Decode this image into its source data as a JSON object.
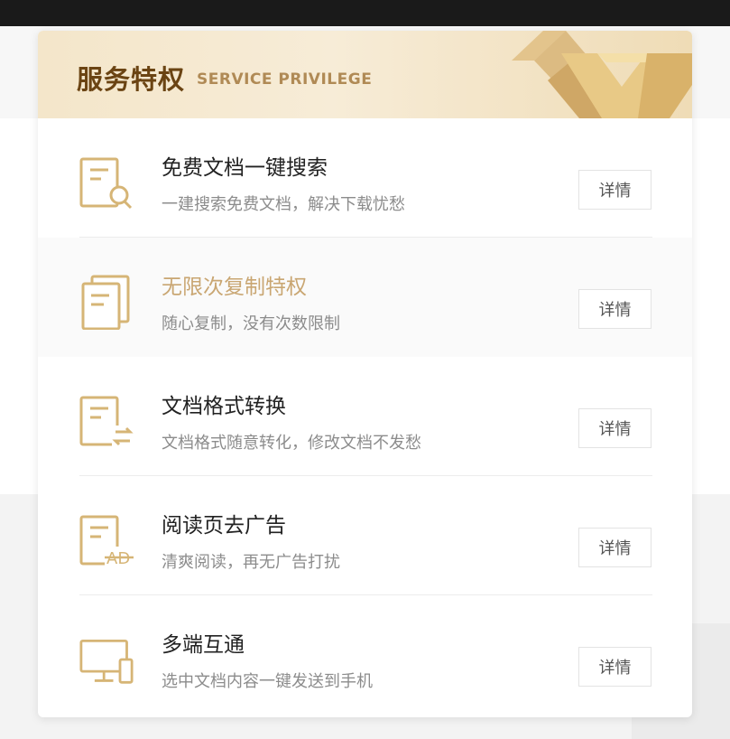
{
  "header": {
    "title": "服务特权",
    "subtitle": "SERVICE PRIVILEGE"
  },
  "features": [
    {
      "title": "免费文档一键搜索",
      "desc": "一建搜索免费文档，解决下载忧愁",
      "button": "详情",
      "icon": "document-search-icon"
    },
    {
      "title": "无限次复制特权",
      "desc": "随心复制，没有次数限制",
      "button": "详情",
      "icon": "copy-documents-icon",
      "active": true
    },
    {
      "title": "文档格式转换",
      "desc": "文档格式随意转化，修改文档不发愁",
      "button": "详情",
      "icon": "document-convert-icon"
    },
    {
      "title": "阅读页去广告",
      "desc": "清爽阅读，再无广告打扰",
      "button": "详情",
      "icon": "no-ads-icon"
    },
    {
      "title": "多端互通",
      "desc": "选中文档内容一键发送到手机",
      "button": "详情",
      "icon": "multi-device-icon"
    }
  ],
  "colors": {
    "accent": "#c9a672",
    "title_dark": "#6b4413",
    "header_bg": "#f4e6ca"
  }
}
